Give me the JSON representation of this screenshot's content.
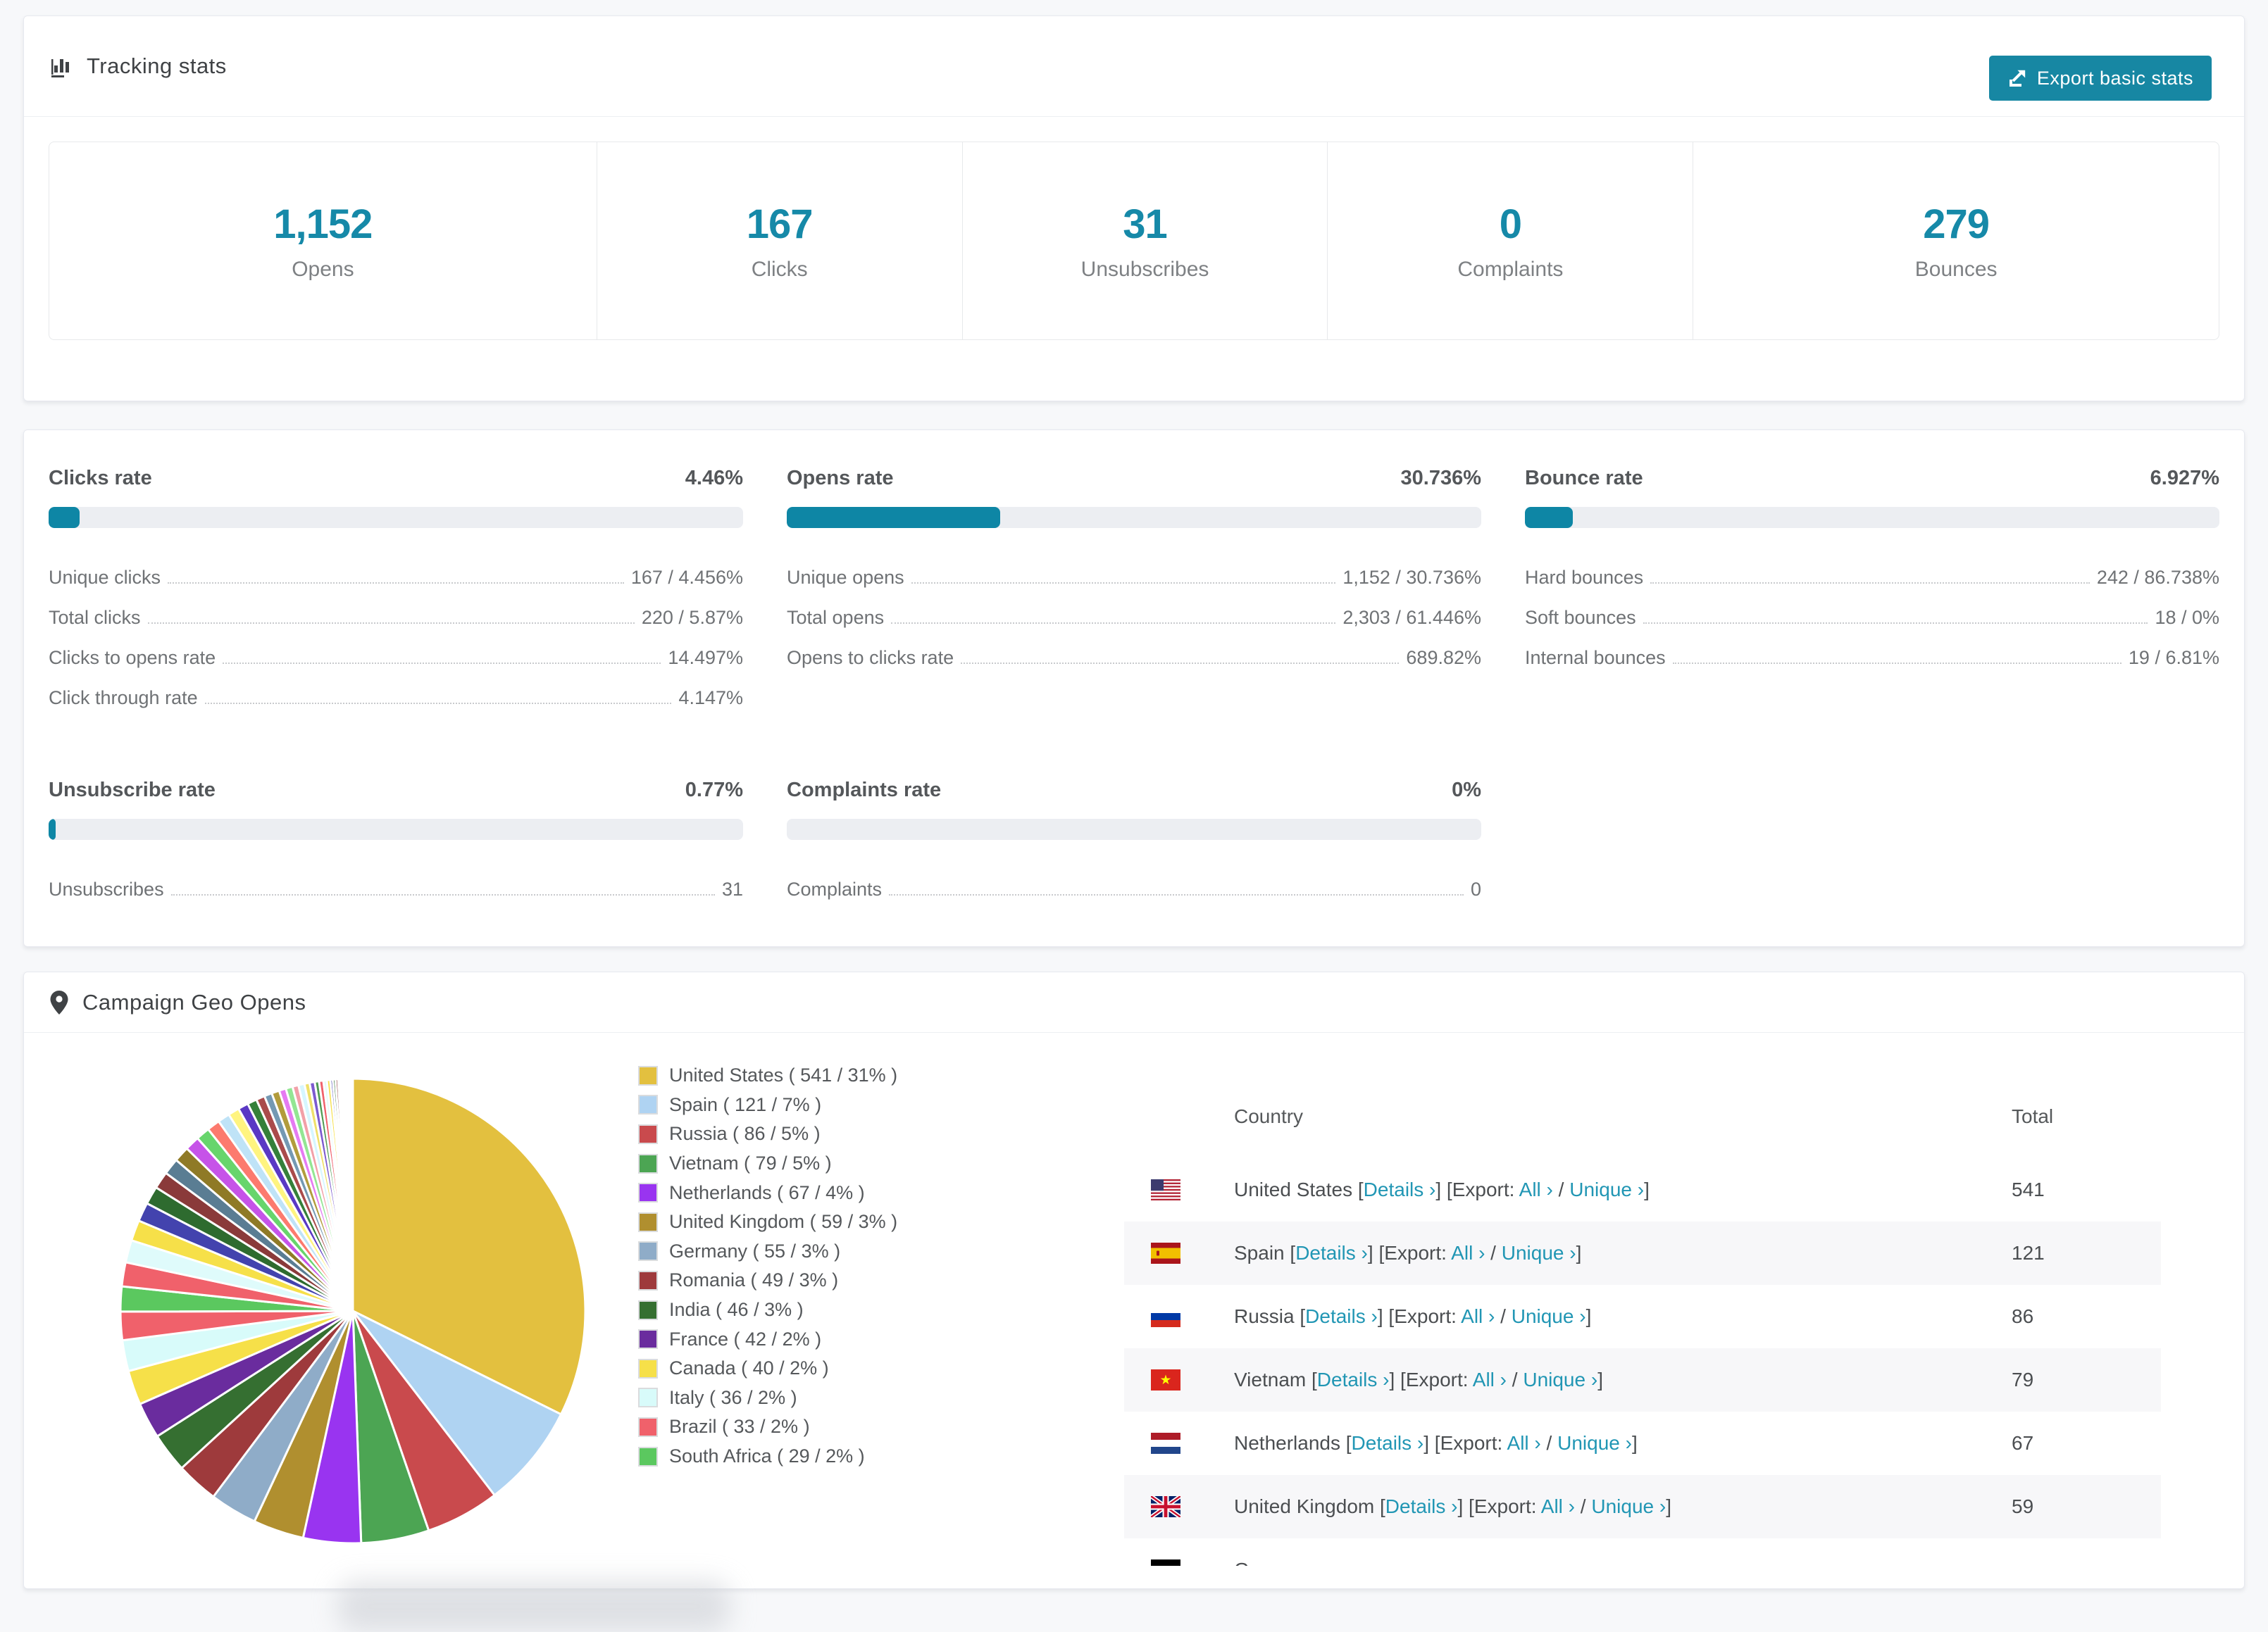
{
  "colors": {
    "accent_teal": "#1689a8",
    "progress_teal": "#0e86a5",
    "link_teal": "#2196b4",
    "button_teal": "#1787a3",
    "track_gray": "#eceef2",
    "row_stripe": "#f7f7f9"
  },
  "tracking": {
    "title": "Tracking stats",
    "export_button": "Export basic stats",
    "stats": [
      {
        "value": "1,152",
        "label": "Opens"
      },
      {
        "value": "167",
        "label": "Clicks"
      },
      {
        "value": "31",
        "label": "Unsubscribes"
      },
      {
        "value": "0",
        "label": "Complaints"
      },
      {
        "value": "279",
        "label": "Bounces"
      }
    ]
  },
  "rates": [
    {
      "title": "Clicks rate",
      "value": "4.46%",
      "percent": 4.46,
      "rows": [
        {
          "label": "Unique clicks",
          "value": "167 / 4.456%"
        },
        {
          "label": "Total clicks",
          "value": "220 / 5.87%"
        },
        {
          "label": "Clicks to opens rate",
          "value": "14.497%"
        },
        {
          "label": "Click through rate",
          "value": "4.147%"
        }
      ]
    },
    {
      "title": "Opens rate",
      "value": "30.736%",
      "percent": 30.736,
      "rows": [
        {
          "label": "Unique opens",
          "value": "1,152 / 30.736%"
        },
        {
          "label": "Total opens",
          "value": "2,303 / 61.446%"
        },
        {
          "label": "Opens to clicks rate",
          "value": "689.82%"
        }
      ]
    },
    {
      "title": "Bounce rate",
      "value": "6.927%",
      "percent": 6.927,
      "rows": [
        {
          "label": "Hard bounces",
          "value": "242 / 86.738%"
        },
        {
          "label": "Soft bounces",
          "value": "18 / 0%"
        },
        {
          "label": "Internal bounces",
          "value": "19 / 6.81%"
        }
      ]
    },
    {
      "title": "Unsubscribe rate",
      "value": "0.77%",
      "percent": 0.77,
      "rows": [
        {
          "label": "Unsubscribes",
          "value": "31"
        }
      ]
    },
    {
      "title": "Complaints rate",
      "value": "0%",
      "percent": 0,
      "rows": [
        {
          "label": "Complaints",
          "value": "0"
        }
      ]
    }
  ],
  "geo": {
    "title": "Campaign Geo Opens",
    "legend_labels": [
      "United States ( 541 / 31% )",
      "Spain ( 121 / 7% )",
      "Russia ( 86 / 5% )",
      "Vietnam ( 79 / 5% )",
      "Netherlands ( 67 / 4% )",
      "United Kingdom ( 59 / 3% )",
      "Germany ( 55 / 3% )",
      "Romania ( 49 / 3% )",
      "India ( 46 / 3% )",
      "France ( 42 / 2% )",
      "Canada ( 40 / 2% )",
      "Italy ( 36 / 2% )",
      "Brazil ( 33 / 2% )",
      "South Africa ( 29 / 2% )"
    ],
    "table": {
      "col_country": "Country",
      "col_total": "Total",
      "tok_ob": "[",
      "tok_details": "Details ›",
      "tok_mid": "] [Export: ",
      "tok_all": "All ›",
      "tok_slash": " / ",
      "tok_unique": "Unique ›",
      "tok_cb": "]",
      "rows": [
        {
          "country": "United States",
          "total": "541"
        },
        {
          "country": "Spain",
          "total": "121"
        },
        {
          "country": "Russia",
          "total": "86"
        },
        {
          "country": "Vietnam",
          "total": "79"
        },
        {
          "country": "Netherlands",
          "total": "67"
        },
        {
          "country": "United Kingdom",
          "total": "59"
        },
        {
          "country": "Germany",
          "total": ""
        }
      ]
    }
  },
  "chart_data": {
    "type": "pie",
    "title": "Campaign Geo Opens",
    "unit": "opens",
    "legend_position": "right",
    "start_angle_deg": -90,
    "direction": "clockwise",
    "series": [
      {
        "name": "United States",
        "value": 541,
        "pct": 31,
        "color": "#E3C03F"
      },
      {
        "name": "Spain",
        "value": 121,
        "pct": 7,
        "color": "#AFD3F2"
      },
      {
        "name": "Russia",
        "value": 86,
        "pct": 5,
        "color": "#C94A4D"
      },
      {
        "name": "Vietnam",
        "value": 79,
        "pct": 5,
        "color": "#4CA553"
      },
      {
        "name": "Netherlands",
        "value": 67,
        "pct": 4,
        "color": "#9934F0"
      },
      {
        "name": "United Kingdom",
        "value": 59,
        "pct": 3,
        "color": "#B08F2F"
      },
      {
        "name": "Germany",
        "value": 55,
        "pct": 3,
        "color": "#8FACC8"
      },
      {
        "name": "Romania",
        "value": 49,
        "pct": 3,
        "color": "#9E3A3C"
      },
      {
        "name": "India",
        "value": 46,
        "pct": 3,
        "color": "#356F31"
      },
      {
        "name": "France",
        "value": 42,
        "pct": 2,
        "color": "#6A2C9E"
      },
      {
        "name": "Canada",
        "value": 40,
        "pct": 2,
        "color": "#F6E049"
      },
      {
        "name": "Italy",
        "value": 36,
        "pct": 2,
        "color": "#D8FBFA"
      },
      {
        "name": "Brazil",
        "value": 33,
        "pct": 2,
        "color": "#F0616B"
      },
      {
        "name": "South Africa",
        "value": 29,
        "pct": 2,
        "color": "#5BC85F"
      }
    ],
    "other_slices": [
      28,
      26,
      24,
      22,
      21,
      20,
      19,
      18,
      17,
      16,
      15,
      14,
      13,
      12,
      11,
      10,
      9,
      9,
      8,
      8,
      7,
      7,
      6,
      6,
      5,
      5,
      4,
      4,
      3,
      3,
      3,
      2,
      2,
      2,
      2,
      1,
      1,
      1,
      1,
      1,
      1,
      1,
      1,
      1
    ],
    "other_palette": [
      "#F0616B",
      "#DFFBFB",
      "#F6E049",
      "#4343AE",
      "#2E6B2F",
      "#8A3A3A",
      "#5A7D93",
      "#8F7A26",
      "#C653E8",
      "#67D56C",
      "#FC7A6E",
      "#BFE3F7",
      "#FFF480",
      "#5A38C4",
      "#35803A",
      "#AA4B4B",
      "#7499B3",
      "#B29C3C",
      "#E57BF2",
      "#93E693",
      "#F2A0A8",
      "#D6F6FF",
      "#EFE06A",
      "#7C5ACF",
      "#4F9B53"
    ]
  }
}
